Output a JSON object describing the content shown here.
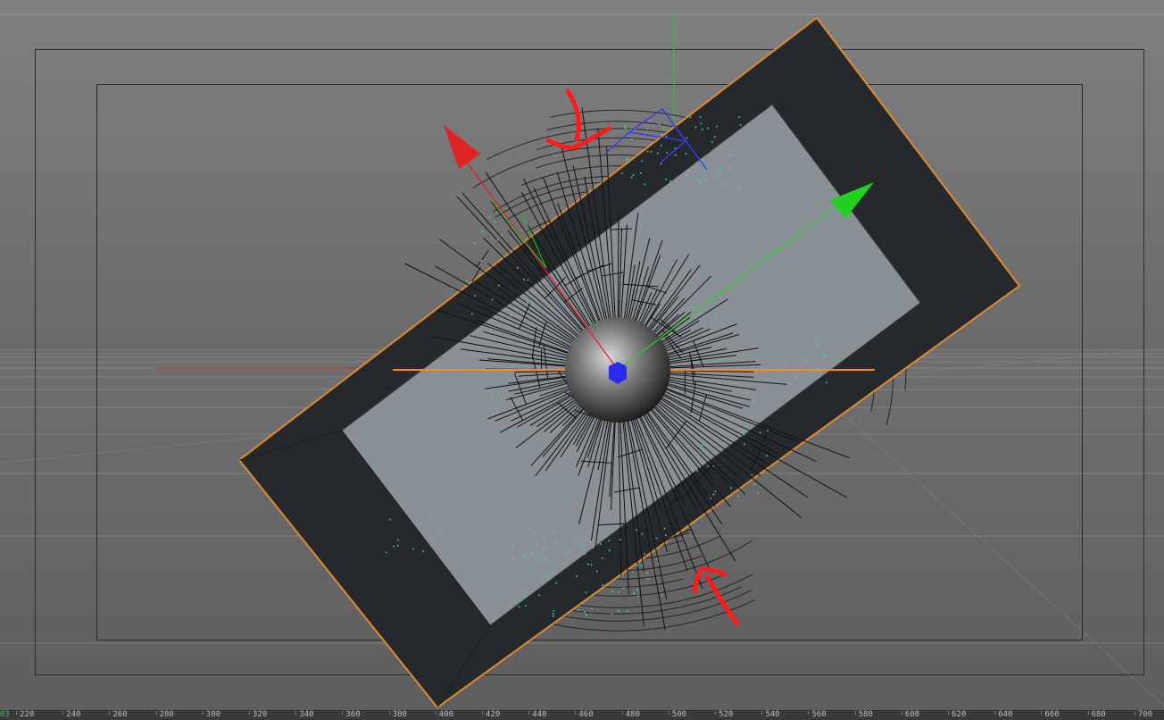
{
  "viewport": {
    "name": "perspective-viewport",
    "colors": {
      "sky_top": "#7c7c7c",
      "sky_bottom": "#6f6f6f",
      "ground": "#666666",
      "grid_line": "#8a8a8a",
      "frame_border": "#2b2b2b",
      "slab_outline": "#e08a30",
      "slab_dark": "#262829",
      "slab_face": "#8b9296",
      "emitter_lines": "#111111",
      "particle": "#32e0a0",
      "axis_x": "#e02020",
      "axis_y": "#22d022",
      "axis_z": "#2222ff",
      "annotation": "#ff1a1a",
      "horizon_orange": "#ff8a1a"
    }
  },
  "timeline": {
    "current_frame": "03",
    "ticks": [
      "220",
      "240",
      "260",
      "280",
      "300",
      "320",
      "340",
      "360",
      "380",
      "400",
      "420",
      "440",
      "460",
      "480",
      "500",
      "520",
      "540",
      "560",
      "580",
      "600",
      "620",
      "640",
      "660",
      "680",
      "700"
    ]
  }
}
